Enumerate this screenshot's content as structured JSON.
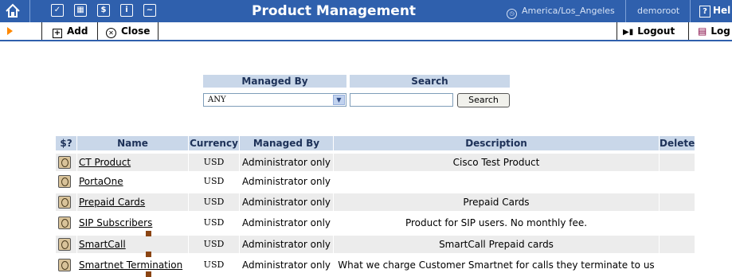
{
  "header": {
    "title": "Product Management",
    "timezone": "America/Los_Angeles",
    "user": "demoroot",
    "help_label": "Hel",
    "icons": [
      "home-icon",
      "check-icon",
      "grid-icon",
      "dollar-icon",
      "info-icon",
      "chart-icon"
    ]
  },
  "toolbar": {
    "add_label": "Add",
    "close_label": "Close",
    "logout_label": "Logout",
    "log_label": "Log"
  },
  "filter": {
    "managed_by_header": "Managed By",
    "search_header": "Search",
    "managed_by_value": "ANY",
    "search_value": "",
    "search_button_label": "Search"
  },
  "table": {
    "columns": [
      "$?",
      "Name",
      "Currency",
      "Managed By",
      "Description",
      "Delete"
    ],
    "rows": [
      {
        "name": "CT Product",
        "currency": "USD",
        "managed_by": "Administrator only",
        "description": "Cisco Test Product"
      },
      {
        "name": "PortaOne",
        "currency": "USD",
        "managed_by": "Administrator only",
        "description": ""
      },
      {
        "name": "Prepaid Cards",
        "currency": "USD",
        "managed_by": "Administrator only",
        "description": "Prepaid Cards"
      },
      {
        "name": "SIP Subscribers",
        "currency": "USD",
        "managed_by": "Administrator only",
        "description": "Product for SIP users. No monthly fee."
      },
      {
        "name": "SmartCall",
        "currency": "USD",
        "managed_by": "Administrator only",
        "description": "SmartCall Prepaid cards"
      },
      {
        "name": "Smartnet Termination",
        "currency": "USD",
        "managed_by": "Administrator only",
        "description": "What we charge Customer Smartnet for calls they terminate to us"
      }
    ]
  },
  "colors": {
    "header_bg": "#2f60ad",
    "table_header_bg": "#c9d7e9",
    "row_alt_bg": "#ececec",
    "accent_arrow": "#ff8800"
  }
}
